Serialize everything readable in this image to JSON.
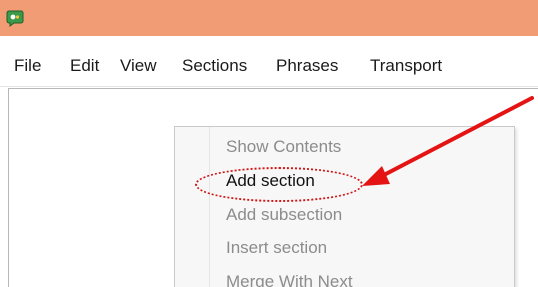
{
  "window": {
    "app_icon": "speech-bubble-app-icon",
    "titlebar_color": "#f29c76"
  },
  "menubar": {
    "items": [
      {
        "label": "File"
      },
      {
        "label": "Edit"
      },
      {
        "label": "View"
      },
      {
        "label": "Sections"
      },
      {
        "label": "Phrases"
      },
      {
        "label": "Transport"
      }
    ]
  },
  "context_menu": {
    "items": [
      {
        "label": "Show Contents",
        "enabled": false
      },
      {
        "label": "Add section",
        "enabled": true
      },
      {
        "label": "Add subsection",
        "enabled": false
      },
      {
        "label": "Insert section",
        "enabled": false
      },
      {
        "label": "Merge With Next",
        "enabled": false
      }
    ]
  },
  "annotation": {
    "color": "#e41414",
    "target": "Add section",
    "shapes": [
      "dotted-ellipse",
      "arrow"
    ]
  }
}
